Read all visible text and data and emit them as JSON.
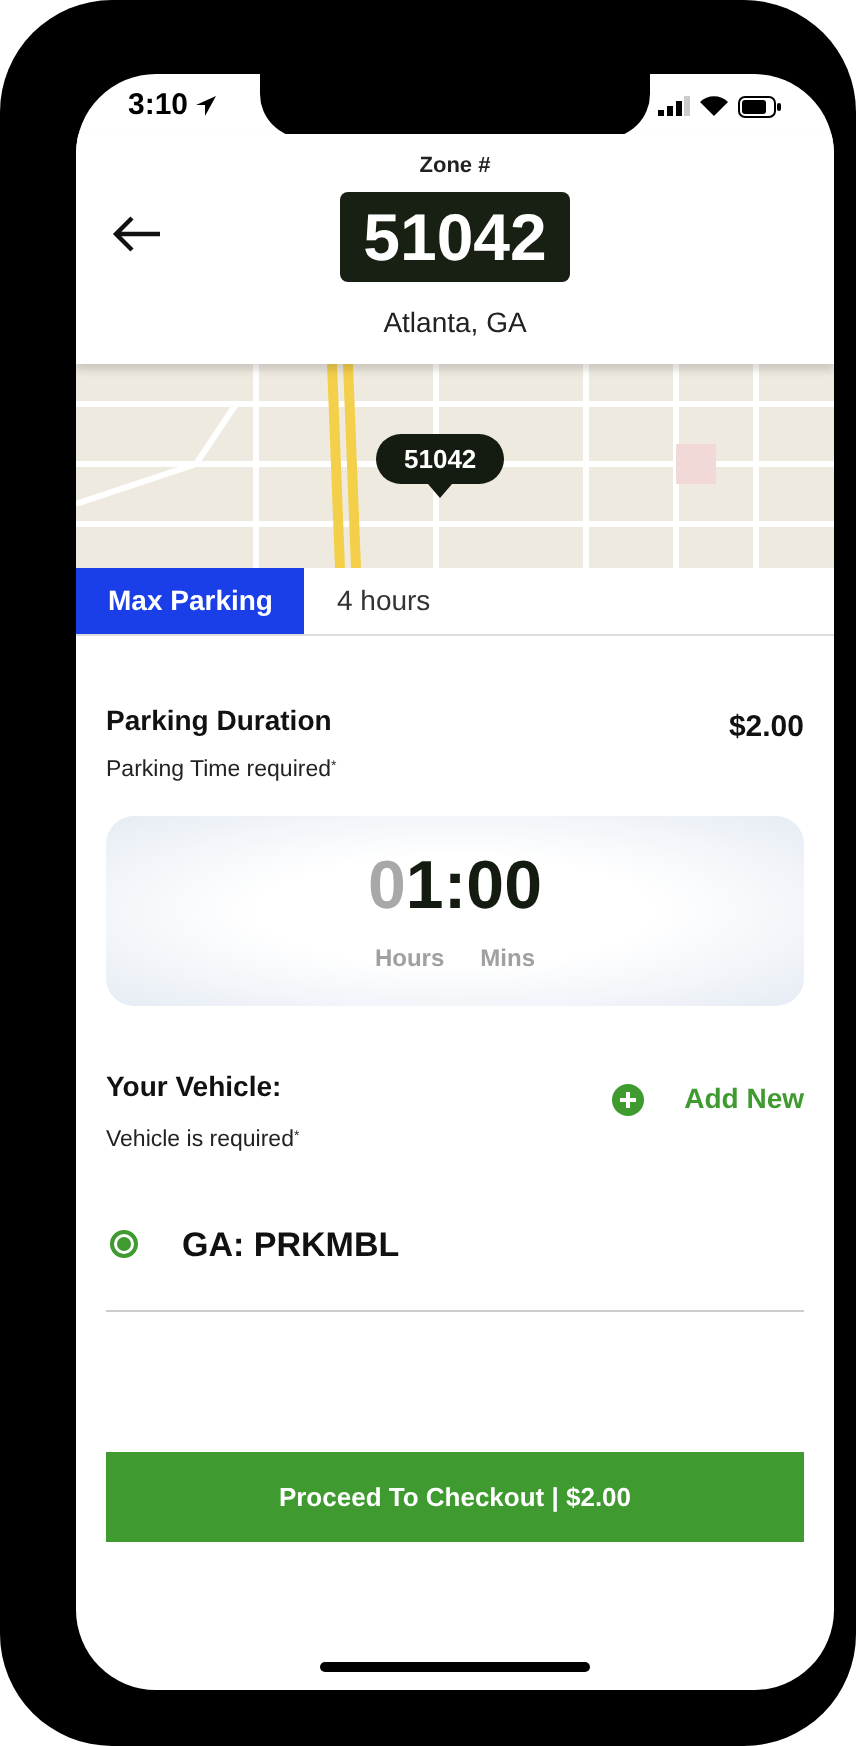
{
  "status_bar": {
    "time": "3:10"
  },
  "header": {
    "zone_label": "Zone #",
    "zone_number": "51042",
    "city": "Atlanta, GA"
  },
  "map": {
    "pin_label": "51042"
  },
  "tabs": [
    {
      "label": "Max Parking",
      "selected": true
    },
    {
      "label": "4 hours",
      "selected": false
    }
  ],
  "duration": {
    "title": "Parking Duration",
    "price": "$2.00",
    "note": "Parking Time required$^{*}$",
    "time_parts": [
      {
        "text": "0",
        "dim": true
      },
      {
        "text": "1:00",
        "dim": false
      }
    ],
    "units": [
      "Hours",
      "Mins"
    ]
  },
  "vehicle": {
    "title": "Your Vehicle:",
    "note": "Vehicle is required$^{*}$",
    "add_label": "Add New",
    "items": [
      {
        "plate": "GA: PRKMBL",
        "selected": true
      }
    ]
  },
  "checkout": {
    "label": "Proceed To Checkout | $2.00"
  }
}
